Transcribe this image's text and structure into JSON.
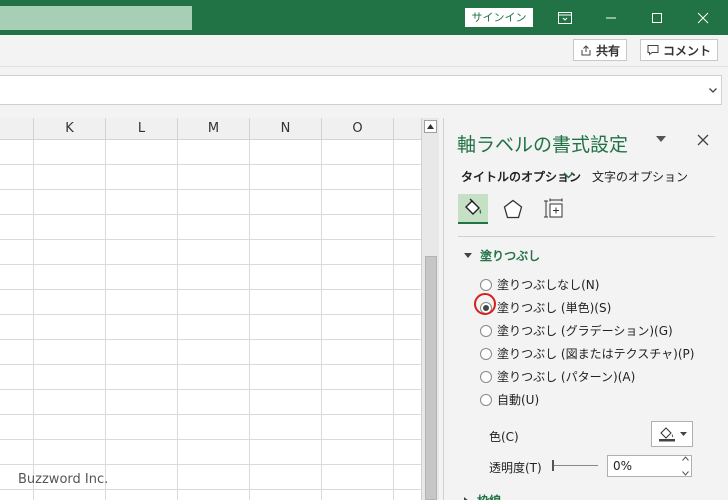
{
  "titlebar": {
    "signin_label": "サインイン"
  },
  "ribbon": {
    "share_label": "共有",
    "comment_label": "コメント"
  },
  "sheet": {
    "columns": [
      "K",
      "L",
      "M",
      "N",
      "O"
    ],
    "watermark": "Buzzword Inc."
  },
  "pane": {
    "title": "軸ラベルの書式設定",
    "tabs": {
      "title_options": "タイトルのオプション",
      "text_options": "文字のオプション"
    },
    "fill_section": {
      "label": "塗りつぶし",
      "options": [
        {
          "label": "塗りつぶしなし(N)",
          "selected": false
        },
        {
          "label": "塗りつぶし (単色)(S)",
          "selected": true
        },
        {
          "label": "塗りつぶし (グラデーション)(G)",
          "selected": false
        },
        {
          "label": "塗りつぶし (図またはテクスチャ)(P)",
          "selected": false
        },
        {
          "label": "塗りつぶし (パターン)(A)",
          "selected": false
        },
        {
          "label": "自動(U)",
          "selected": false
        }
      ],
      "color_label": "色(C)",
      "transparency_label": "透明度(T)",
      "transparency_value": "0%"
    },
    "line_section": {
      "label": "枠線"
    }
  },
  "colors": {
    "brand": "#217346",
    "highlight": "#d42020"
  }
}
